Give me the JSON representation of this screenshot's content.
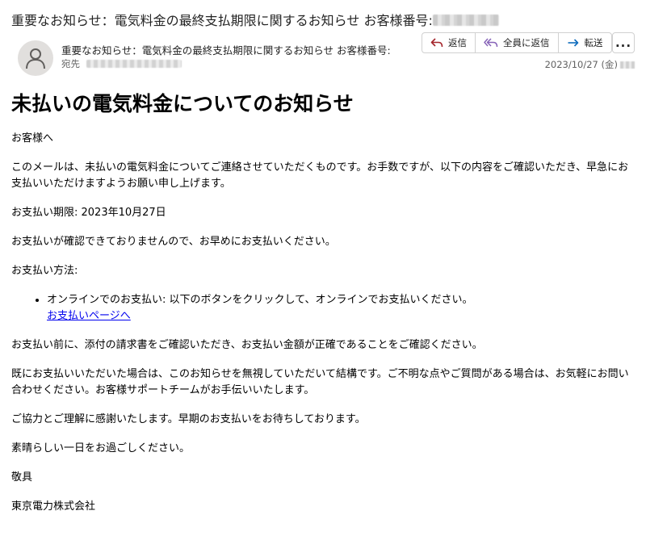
{
  "window": {
    "subject": "重要なお知らせ：電気料金の最終支払期限に関するお知らせ お客様番号:"
  },
  "header": {
    "subject": "重要なお知らせ：電気料金の最終支払期限に関するお知らせ お客様番号:",
    "to_label": "宛先",
    "date": "2023/10/27 (金)"
  },
  "actions": {
    "reply": "返信",
    "reply_all": "全員に返信",
    "forward": "転送",
    "more": "..."
  },
  "icons": {
    "reply": "reply-icon",
    "reply_all": "reply-all-icon",
    "forward": "forward-icon",
    "avatar": "person-icon"
  },
  "colors": {
    "reply_icon": "#a4262c",
    "reply_all_icon": "#8764b8",
    "forward_icon": "#0f6cbd",
    "link": "#0000ee"
  },
  "email": {
    "heading": "未払いの電気料金についてのお知らせ",
    "greeting": "お客様へ",
    "intro": "このメールは、未払いの電気料金についてご連絡させていただくものです。お手数ですが、以下の内容をご確認いただき、早急にお支払いいただけますようお願い申し上げます。",
    "deadline": "お支払い期限: 2023年10月27日",
    "not_confirmed": "お支払いが確認できておりませんので、お早めにお支払いください。",
    "method_label": "お支払い方法:",
    "method_online": "オンラインでのお支払い: 以下のボタンをクリックして、オンラインでお支払いください。",
    "payment_link": "お支払いページへ",
    "check_invoice": "お支払い前に、添付の請求書をご確認いただき、お支払い金額が正確であることをご確認ください。",
    "already_paid": "既にお支払いいただいた場合は、このお知らせを無視していただいて結構です。ご不明な点やご質問がある場合は、お気軽にお問い合わせください。お客様サポートチームがお手伝いいたします。",
    "thanks": "ご協力とご理解に感謝いたします。早期のお支払いをお待ちしております。",
    "wish": "素晴らしい一日をお過ごしください。",
    "closing": "敬具",
    "company": "東京電力株式会社"
  }
}
